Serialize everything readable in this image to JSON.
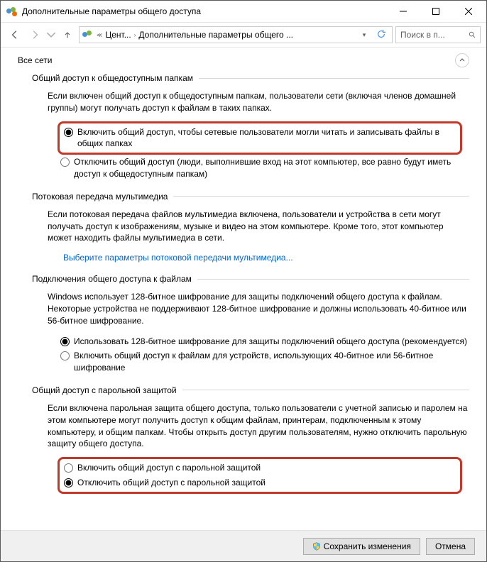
{
  "window": {
    "title": "Дополнительные параметры общего доступа"
  },
  "breadcrumb": {
    "item1": "Цент...",
    "item2": "Дополнительные параметры общего ..."
  },
  "search": {
    "placeholder": "Поиск в п..."
  },
  "profile": "Все сети",
  "sections": {
    "public_folders": {
      "title": "Общий доступ к общедоступным папкам",
      "desc": "Если включен общий доступ к общедоступным папкам, пользователи сети (включая членов домашней группы) могут получать доступ к файлам в таких папках.",
      "opt1": "Включить общий доступ, чтобы сетевые пользователи могли читать и записывать файлы в общих папках",
      "opt2": "Отключить общий доступ (люди, выполнившие вход на этот компьютер, все равно будут иметь доступ к общедоступным папкам)"
    },
    "media": {
      "title": "Потоковая передача мультимедиа",
      "desc": "Если потоковая передача файлов мультимедиа включена, пользователи и устройства в сети могут получать доступ к изображениям, музыке и видео на этом компьютере. Кроме того, этот компьютер может находить файлы мультимедиа в сети.",
      "link": "Выберите параметры потоковой передачи мультимедиа..."
    },
    "encryption": {
      "title": "Подключения общего доступа к файлам",
      "desc": "Windows использует 128-битное шифрование для защиты подключений общего доступа к файлам. Некоторые устройства не поддерживают 128-битное шифрование и должны использовать 40-битное или 56-битное шифрование.",
      "opt1": "Использовать 128-битное шифрование для защиты подключений общего доступа (рекомендуется)",
      "opt2": "Включить общий доступ к файлам для устройств, использующих 40-битное или 56-битное шифрование"
    },
    "password": {
      "title": "Общий доступ с парольной защитой",
      "desc": "Если включена парольная защита общего доступа, только пользователи с учетной записью и паролем на этом компьютере могут получить доступ к общим файлам, принтерам, подключенным к этому компьютеру, и общим папкам. Чтобы открыть доступ другим пользователям, нужно отключить парольную защиту общего доступа.",
      "opt1": "Включить общий доступ с парольной защитой",
      "opt2": "Отключить общий доступ с парольной защитой"
    }
  },
  "buttons": {
    "save": "Сохранить изменения",
    "cancel": "Отмена"
  }
}
